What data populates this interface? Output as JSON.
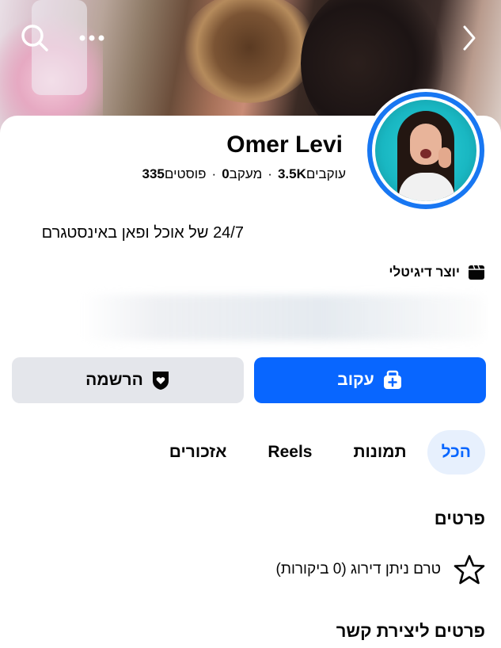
{
  "cover": {
    "icons": [
      "search-icon",
      "more-icon",
      "chevron-right-icon"
    ]
  },
  "profile": {
    "name": "Omer Levi",
    "followers_count": "3.5K",
    "followers_label": "עוקבים",
    "following_count": "0",
    "following_label": "מעקב",
    "posts_count": "335",
    "posts_label": "פוסטים",
    "separator": "·",
    "bio": "24/7 של אוכל ופאן באינסטגרם",
    "category": "יוצר דיגיטלי",
    "category_icon": "clapperboard-icon"
  },
  "actions": {
    "follow_label": "עקוב",
    "follow_icon": "follow-badge-icon",
    "register_label": "הרשמה",
    "register_icon": "heart-shield-icon"
  },
  "tabs": [
    {
      "label": "הכל",
      "active": true
    },
    {
      "label": "תמונות",
      "active": false
    },
    {
      "label": "Reels",
      "active": false
    },
    {
      "label": "אזכורים",
      "active": false
    }
  ],
  "details": {
    "title": "פרטים",
    "rating_text": "טרם ניתן דירוג (0 ביקורות)",
    "rating_icon": "star-icon"
  },
  "contact": {
    "title": "פרטים ליצירת קשר"
  },
  "colors": {
    "accent": "#0866ff",
    "ring": "#1877f2",
    "secondary_button": "#e4e6eb",
    "active_tab_bg": "#e7f0fd"
  }
}
